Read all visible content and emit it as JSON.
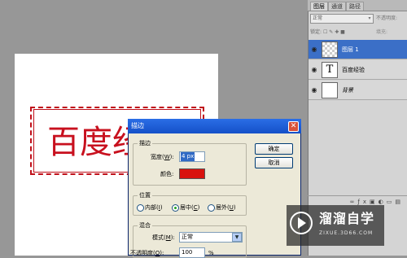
{
  "canvas": {
    "text": "百度经",
    "stroke_color": "#c8101e"
  },
  "layers_panel": {
    "tabs": [
      {
        "label": "图层",
        "active": true
      },
      {
        "label": "通道",
        "active": false
      },
      {
        "label": "路径",
        "active": false
      }
    ],
    "blend_mode": "正常",
    "opacity_label": "不透明度:",
    "lock_label": "锁定:",
    "fill_label": "填充:",
    "layers": [
      {
        "name": "图层 1",
        "thumb": "transparent",
        "selected": true
      },
      {
        "name": "百度经验",
        "thumb": "text",
        "thumb_glyph": "T",
        "selected": false
      },
      {
        "name": "背景",
        "thumb": "white",
        "selected": false
      }
    ]
  },
  "dialog": {
    "title": "描边",
    "close": "✕",
    "stroke_group": {
      "title": "描边",
      "width_label_pre": "宽度(",
      "width_key": "W",
      "width_label_post": "):",
      "width_value": "4 px",
      "color_label": "颜色:",
      "color": "#d8120e"
    },
    "position_group": {
      "title": "位置",
      "options": [
        {
          "label_pre": "内部(",
          "key": "I",
          "label_post": ")",
          "checked": false
        },
        {
          "label_pre": "居中(",
          "key": "C",
          "label_post": ")",
          "checked": true
        },
        {
          "label_pre": "居外(",
          "key": "U",
          "label_post": ")",
          "checked": false
        }
      ]
    },
    "blend_group": {
      "title": "混合",
      "mode_label_pre": "模式(",
      "mode_key": "M",
      "mode_label_post": "):",
      "mode_value": "正常",
      "opacity_label_pre": "不透明度(",
      "opacity_key": "O",
      "opacity_label_post": "):",
      "opacity_value": "100",
      "opacity_unit": "%"
    },
    "ok_label": "确定",
    "cancel_label": "取消"
  },
  "watermark": {
    "title": "溜溜自学",
    "url": "ZIXUE.3D66.COM"
  }
}
